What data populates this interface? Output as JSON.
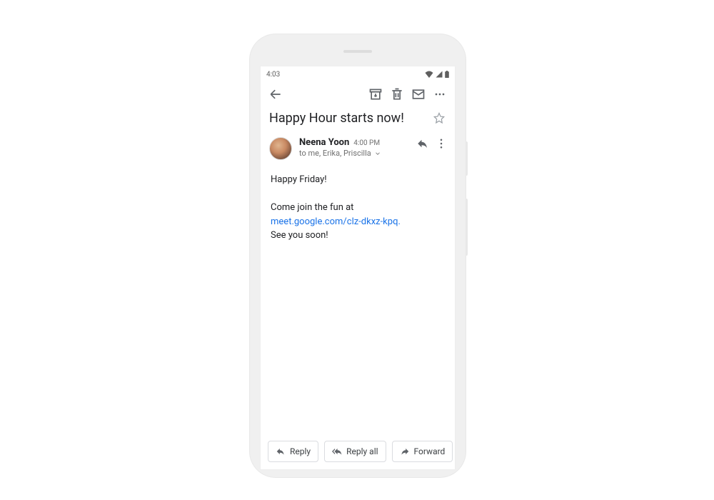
{
  "statusbar": {
    "time": "4:03"
  },
  "email": {
    "subject": "Happy Hour starts now!",
    "sender": {
      "name": "Neena Yoon",
      "time": "4:00 PM",
      "recipients": "to me, Erika, Priscilla"
    },
    "body": {
      "line1": "Happy Friday!",
      "line2a": "Come join the fun at ",
      "link": "meet.google.com/clz-dkxz-kpq.",
      "line3": "See you soon!"
    }
  },
  "actions": {
    "reply": "Reply",
    "reply_all": "Reply all",
    "forward": "Forward"
  }
}
